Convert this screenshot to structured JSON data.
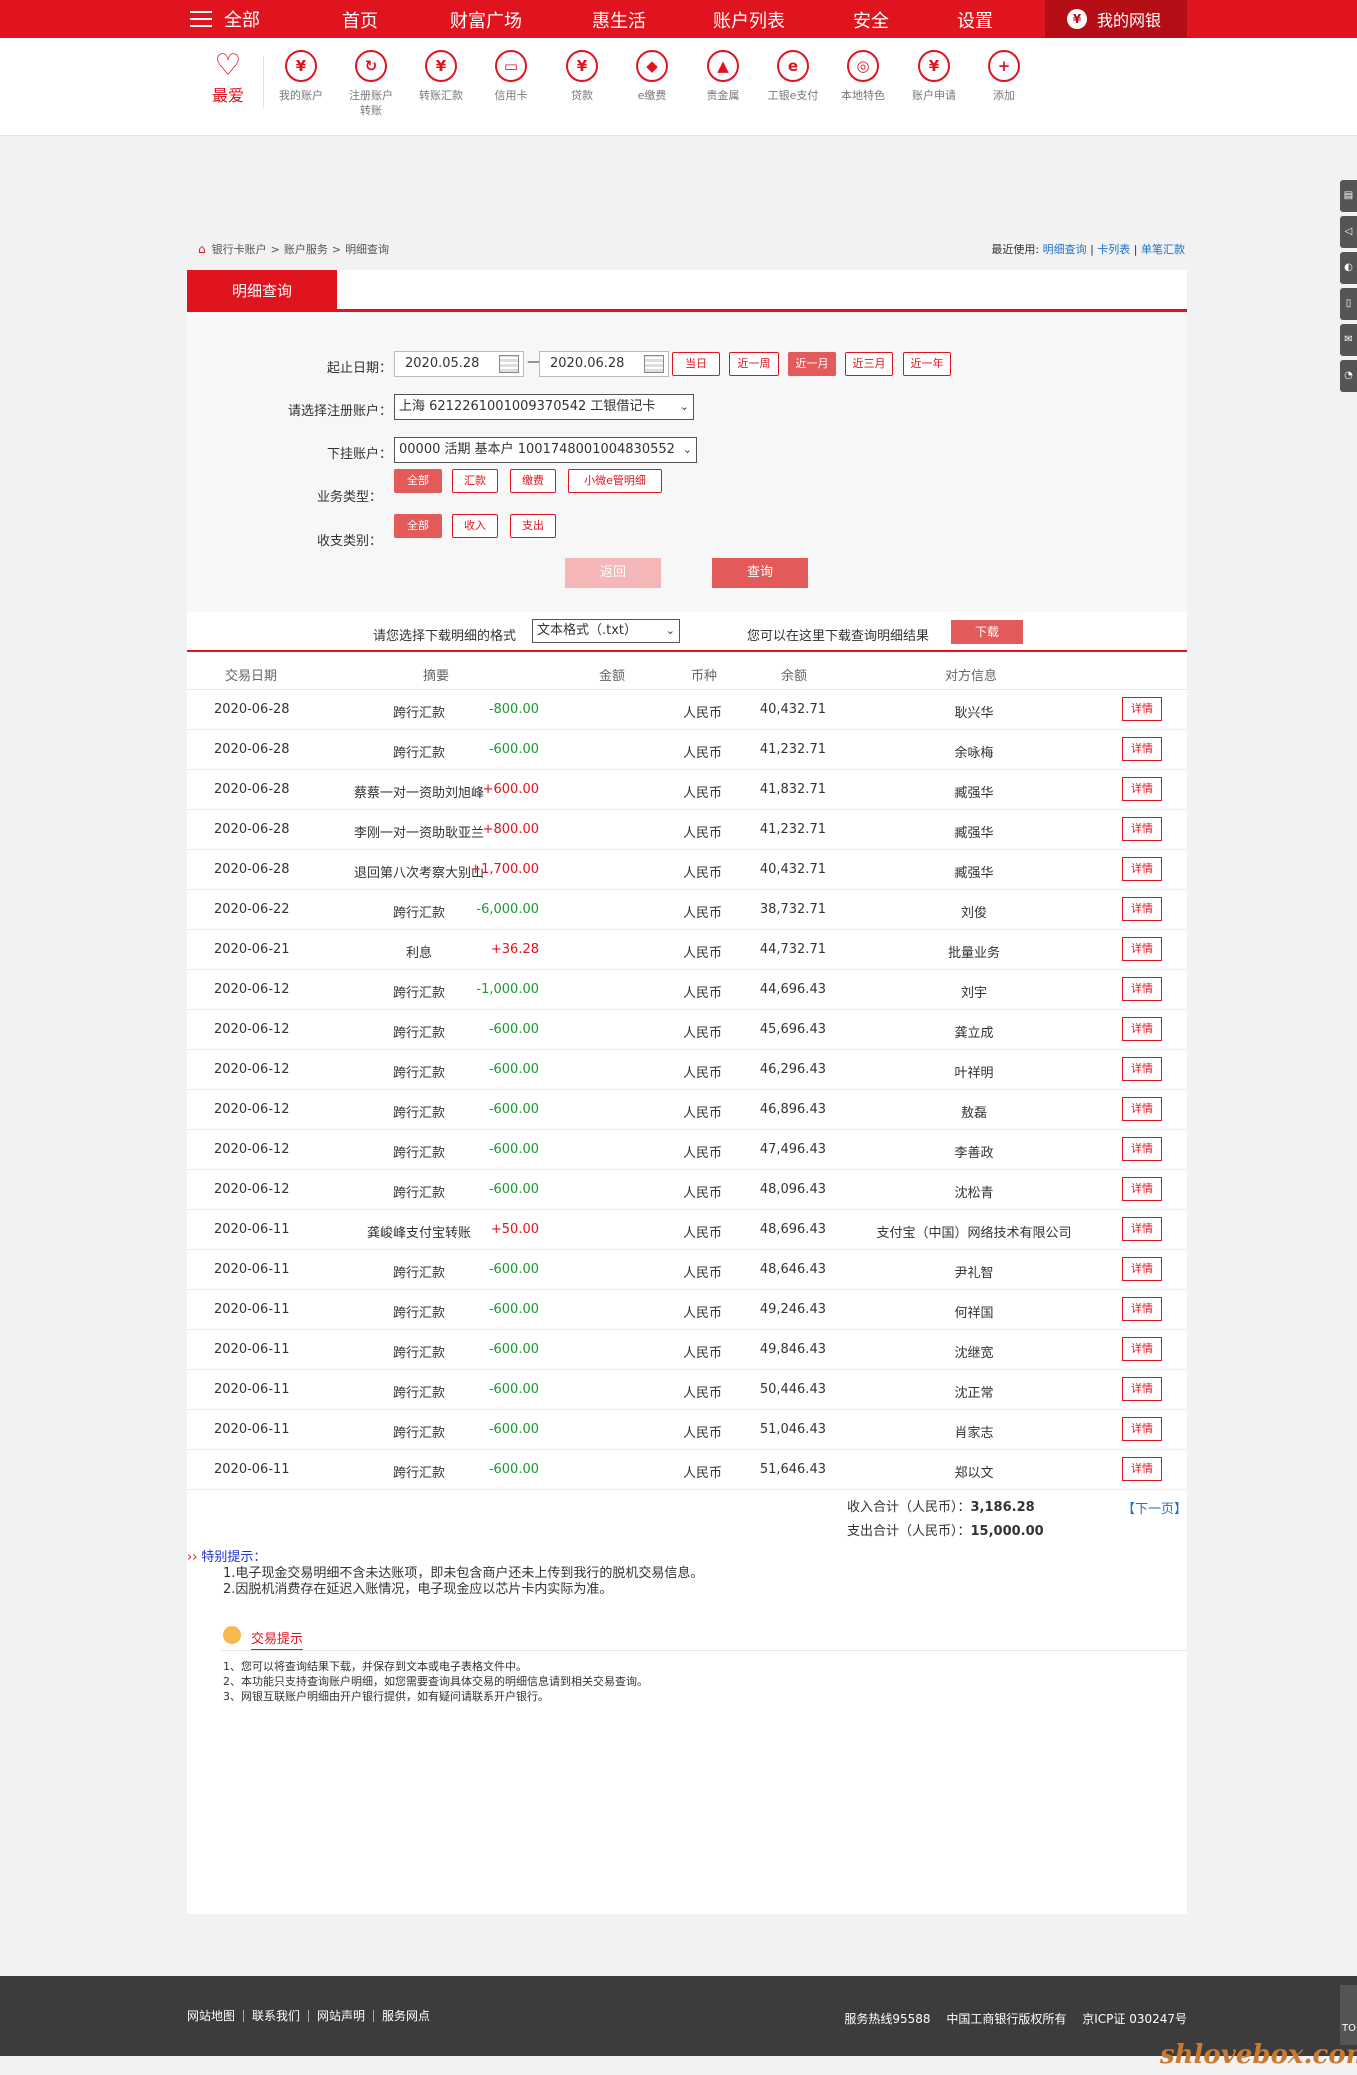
{
  "nav": {
    "all": "全部",
    "items": [
      "首页",
      "财富广场",
      "惠生活",
      "账户列表",
      "安全",
      "设置"
    ],
    "mybank": "我的网银"
  },
  "shortcuts": {
    "fav": "最爱",
    "items": [
      {
        "label": "我的账户",
        "glyph": "¥"
      },
      {
        "label": "注册账户\n转账",
        "glyph": "↻"
      },
      {
        "label": "转账汇款",
        "glyph": "¥"
      },
      {
        "label": "信用卡",
        "glyph": "▭"
      },
      {
        "label": "贷款",
        "glyph": "¥"
      },
      {
        "label": "e缴费",
        "glyph": "◆"
      },
      {
        "label": "贵金属",
        "glyph": "▲"
      },
      {
        "label": "工银e支付",
        "glyph": "e"
      },
      {
        "label": "本地特色",
        "glyph": "◎"
      },
      {
        "label": "账户申请",
        "glyph": "¥"
      },
      {
        "label": "添加",
        "glyph": "+"
      }
    ]
  },
  "breadcrumb": {
    "items": [
      "银行卡账户",
      "账户服务",
      "明细查询"
    ]
  },
  "recent": {
    "label": "最近使用:",
    "links": [
      "明细查询",
      "卡列表",
      "单笔汇款"
    ]
  },
  "tab": "明细查询",
  "form": {
    "date_label": "起止日期：",
    "date_start": "2020.05.28",
    "date_end": "2020.06.28",
    "date_sep": "—",
    "quick": [
      "当日",
      "近一周",
      "近一月",
      "近三月",
      "近一年"
    ],
    "account_label": "请选择注册账户：",
    "account_value": "上海 6212261001009370542 工银借记卡",
    "sub_label": "下挂账户：",
    "sub_value": "00000 活期 基本户 1001748001004830552",
    "biz_label": "业务类型：",
    "biz_options": [
      "全部",
      "汇款",
      "缴费",
      "小微e管明细"
    ],
    "io_label": "收支类别：",
    "io_options": [
      "全部",
      "收入",
      "支出"
    ],
    "back": "返回",
    "query": "查询"
  },
  "download": {
    "label": "请您选择下载明细的格式",
    "format": "文本格式（.txt）",
    "hint": "您可以在这里下载查询明细结果",
    "button": "下载"
  },
  "table": {
    "headers": [
      "交易日期",
      "摘要",
      "金额",
      "币种",
      "余额",
      "对方信息"
    ],
    "detail_label": "详情",
    "rows": [
      [
        "2020-06-28",
        "跨行汇款",
        "-800.00",
        "人民币",
        "40,432.71",
        "耿兴华"
      ],
      [
        "2020-06-28",
        "跨行汇款",
        "-600.00",
        "人民币",
        "41,232.71",
        "余咏梅"
      ],
      [
        "2020-06-28",
        "蔡蔡一对一资助刘旭峰",
        "+600.00",
        "人民币",
        "41,832.71",
        "臧强华"
      ],
      [
        "2020-06-28",
        "李刚一对一资助耿亚兰",
        "+800.00",
        "人民币",
        "41,232.71",
        "臧强华"
      ],
      [
        "2020-06-28",
        "退回第八次考察大别山",
        "+1,700.00",
        "人民币",
        "40,432.71",
        "臧强华"
      ],
      [
        "2020-06-22",
        "跨行汇款",
        "-6,000.00",
        "人民币",
        "38,732.71",
        "刘俊"
      ],
      [
        "2020-06-21",
        "利息",
        "+36.28",
        "人民币",
        "44,732.71",
        "批量业务"
      ],
      [
        "2020-06-12",
        "跨行汇款",
        "-1,000.00",
        "人民币",
        "44,696.43",
        "刘宇"
      ],
      [
        "2020-06-12",
        "跨行汇款",
        "-600.00",
        "人民币",
        "45,696.43",
        "龚立成"
      ],
      [
        "2020-06-12",
        "跨行汇款",
        "-600.00",
        "人民币",
        "46,296.43",
        "叶祥明"
      ],
      [
        "2020-06-12",
        "跨行汇款",
        "-600.00",
        "人民币",
        "46,896.43",
        "敖磊"
      ],
      [
        "2020-06-12",
        "跨行汇款",
        "-600.00",
        "人民币",
        "47,496.43",
        "李善政"
      ],
      [
        "2020-06-12",
        "跨行汇款",
        "-600.00",
        "人民币",
        "48,096.43",
        "沈松青"
      ],
      [
        "2020-06-11",
        "龚峻峰支付宝转账",
        "+50.00",
        "人民币",
        "48,696.43",
        "支付宝（中国）网络技术有限公司"
      ],
      [
        "2020-06-11",
        "跨行汇款",
        "-600.00",
        "人民币",
        "48,646.43",
        "尹礼智"
      ],
      [
        "2020-06-11",
        "跨行汇款",
        "-600.00",
        "人民币",
        "49,246.43",
        "何祥国"
      ],
      [
        "2020-06-11",
        "跨行汇款",
        "-600.00",
        "人民币",
        "49,846.43",
        "沈继宽"
      ],
      [
        "2020-06-11",
        "跨行汇款",
        "-600.00",
        "人民币",
        "50,446.43",
        "沈正常"
      ],
      [
        "2020-06-11",
        "跨行汇款",
        "-600.00",
        "人民币",
        "51,046.43",
        "肖家志"
      ],
      [
        "2020-06-11",
        "跨行汇款",
        "-600.00",
        "人民币",
        "51,646.43",
        "郑以文"
      ]
    ]
  },
  "totals": {
    "income_label": "收入合计（人民币）：",
    "income": "3,186.28",
    "expense_label": "支出合计（人民币）：",
    "expense": "15,000.00",
    "next": "【下一页】"
  },
  "notice": {
    "title": "特别提示：",
    "lines": [
      "1.电子现金交易明细不含未达账项，即未包含商户还未上传到我行的脱机交易信息。",
      "2.因脱机消费存在延迟入账情况，电子现金应以芯片卡内实际为准。"
    ]
  },
  "tips": {
    "title": "交易提示",
    "lines": [
      "1、您可以将查询结果下载，并保存到文本或电子表格文件中。",
      "2、本功能只支持查询账户明细，如您需要查询具体交易的明细信息请到相关交易查询。",
      "3、网银互联账户明细由开户银行提供，如有疑问请联系开户银行。"
    ]
  },
  "footer": {
    "links": [
      "网站地图",
      "联系我们",
      "网站声明",
      "服务网点"
    ],
    "hotline": "服务热线95588",
    "copyright": "中国工商银行版权所有",
    "icp": "京ICP证 030247号"
  },
  "totop": "TO",
  "watermark": "shlovebox.com"
}
